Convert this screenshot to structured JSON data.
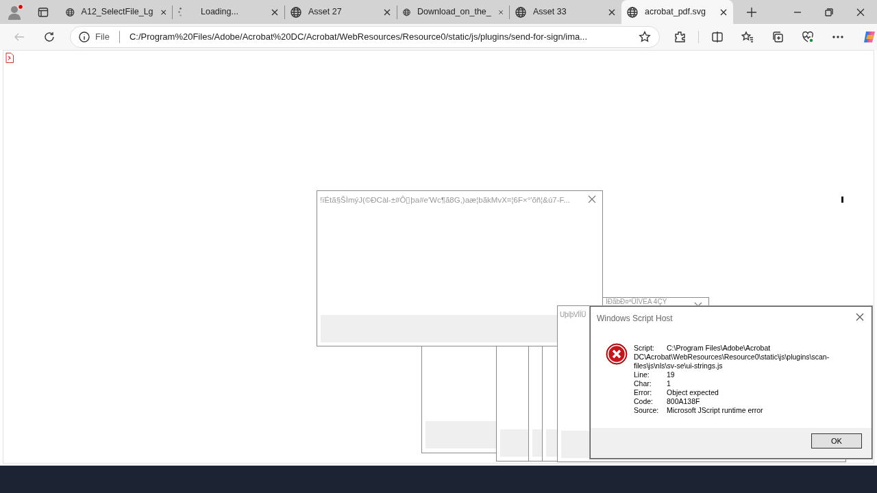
{
  "browser": {
    "tabs": [
      {
        "title": "A12_SelectFile_Lg",
        "kind": "page",
        "selected": false
      },
      {
        "title": "Loading...",
        "kind": "loading",
        "selected": false
      },
      {
        "title": "Asset 27",
        "kind": "page",
        "selected": false
      },
      {
        "title": "Download_on_the_",
        "kind": "page",
        "selected": false
      },
      {
        "title": "Asset 33",
        "kind": "page",
        "selected": false
      },
      {
        "title": "acrobat_pdf.svg",
        "kind": "page",
        "selected": true
      }
    ],
    "address": {
      "scheme": "File",
      "url": "C:/Program%20Files/Adobe/Acrobat%20DC/Acrobat/WebResources/Resource0/static/js/plugins/send-for-sign/ima..."
    }
  },
  "windows": [
    {
      "kind": "blank"
    },
    {
      "kind": "blank"
    },
    {
      "kind": "blank"
    },
    {
      "kind": "blank"
    },
    {
      "kind": "titled",
      "title": "!ïÉtã§ŠÌmýJ(©ÐCàl-±#Ô▯þa#e'Wc¶ã8G,)aæ¦bãkMvX=¦6F×°'õñ¦&ú7-F..."
    },
    {
      "kind": "titled",
      "title": "ÌÐãbÐ¤ªÜÍVEA 4ÇÝ"
    },
    {
      "kind": "titled",
      "title": "UþíþVÍÍÜ"
    }
  ],
  "error_dialog": {
    "title": "Windows Script Host",
    "fields": [
      {
        "label": "Script:",
        "value": "C:\\Program Files\\Adobe\\Acrobat DC\\Acrobat\\WebResources\\Resource0\\static\\js\\plugins\\scan-files\\js\\nls\\sv-se\\ui-strings.js"
      },
      {
        "label": "Line:",
        "value": "19"
      },
      {
        "label": "Char:",
        "value": "1"
      },
      {
        "label": "Error:",
        "value": "Object expected"
      },
      {
        "label": "Code:",
        "value": "800A138F"
      },
      {
        "label": "Source:",
        "value": "Microsoft JScript runtime error"
      }
    ],
    "button": "OK"
  }
}
